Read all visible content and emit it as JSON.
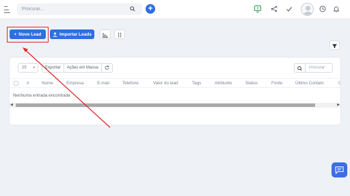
{
  "topbar": {
    "search_placeholder": "Procurar...",
    "icons": [
      "menu-icon",
      "search-icon",
      "add-icon",
      "monitor-dollar-icon",
      "share-icon",
      "check-icon",
      "avatar",
      "history-icon",
      "bell-icon"
    ]
  },
  "toolbar": {
    "new_lead_label": "Novo Lead",
    "import_leads_label": "Importar Leads"
  },
  "table_controls": {
    "page_size": "25",
    "export_label": "Exportar",
    "bulk_actions_label": "Ações em Massa",
    "search_placeholder": "Procurar"
  },
  "table": {
    "columns": [
      "#",
      "Nome",
      "Empresa",
      "E-mail",
      "Telefone",
      "Valor do lead",
      "Tags",
      "Atribuído",
      "Status",
      "Fonte",
      "Último Contato",
      "C"
    ],
    "empty_message": "Nenhuma entrada encontrada"
  },
  "colors": {
    "accent": "#2f6fe0",
    "annotation": "#e0262b",
    "chat_fab": "#3b6fe0"
  }
}
